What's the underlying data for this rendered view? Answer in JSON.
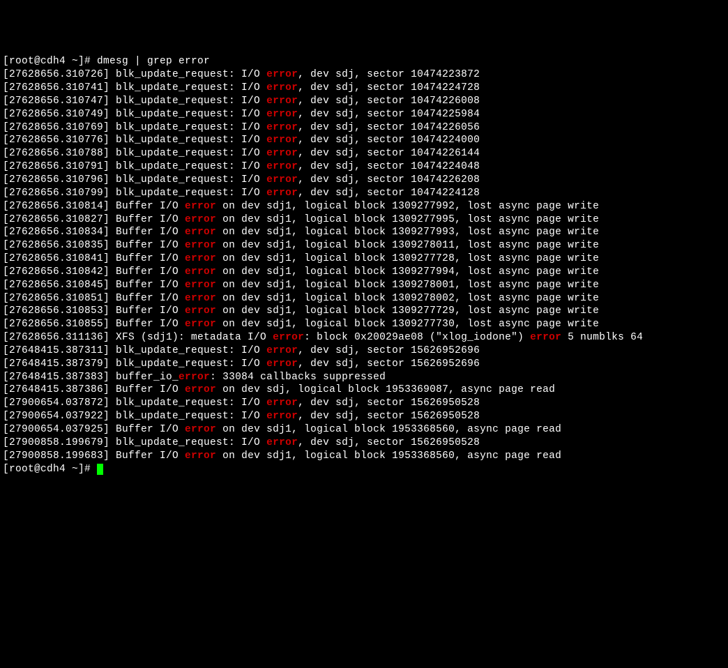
{
  "prompt1": {
    "user": "[root@cdh4 ~]# ",
    "command": "dmesg | grep error"
  },
  "blk_errors": [
    {
      "ts": "27628656.310726",
      "sector": "10474223872"
    },
    {
      "ts": "27628656.310741",
      "sector": "10474224728"
    },
    {
      "ts": "27628656.310747",
      "sector": "10474226008"
    },
    {
      "ts": "27628656.310749",
      "sector": "10474225984"
    },
    {
      "ts": "27628656.310769",
      "sector": "10474226056"
    },
    {
      "ts": "27628656.310776",
      "sector": "10474224000"
    },
    {
      "ts": "27628656.310788",
      "sector": "10474226144"
    },
    {
      "ts": "27628656.310791",
      "sector": "10474224048"
    },
    {
      "ts": "27628656.310796",
      "sector": "10474226208"
    },
    {
      "ts": "27628656.310799",
      "sector": "10474224128"
    }
  ],
  "buffer_errors": [
    {
      "ts": "27628656.310814",
      "block": "1309277992"
    },
    {
      "ts": "27628656.310827",
      "block": "1309277995"
    },
    {
      "ts": "27628656.310834",
      "block": "1309277993"
    },
    {
      "ts": "27628656.310835",
      "block": "1309278011"
    },
    {
      "ts": "27628656.310841",
      "block": "1309277728"
    },
    {
      "ts": "27628656.310842",
      "block": "1309277994"
    },
    {
      "ts": "27628656.310845",
      "block": "1309278001"
    },
    {
      "ts": "27628656.310851",
      "block": "1309278002"
    },
    {
      "ts": "27628656.310853",
      "block": "1309277729"
    },
    {
      "ts": "27628656.310855",
      "block": "1309277730"
    }
  ],
  "xfs_error": {
    "ts": "27628656.311136",
    "pre": "XFS (sdj1): metadata I/O ",
    "mid": ": block 0x20029ae08 (\"xlog_iodone\") ",
    "post": " 5 numblks 64"
  },
  "late_errors": [
    {
      "ts": "27648415.387311",
      "type": "blk",
      "text_pre": "blk_update_request: I/O ",
      "text_post": ", dev sdj, sector 15626952696"
    },
    {
      "ts": "27648415.387379",
      "type": "blk",
      "text_pre": "blk_update_request: I/O ",
      "text_post": ", dev sdj, sector 15626952696"
    },
    {
      "ts": "27648415.387383",
      "type": "suppress",
      "text_pre": "buffer_io_",
      "text_post": ": 33084 callbacks suppressed"
    },
    {
      "ts": "27648415.387386",
      "type": "buf",
      "text_pre": "Buffer I/O ",
      "text_post": " on dev sdj, logical block 1953369087, async page read"
    },
    {
      "ts": "27900654.037872",
      "type": "blk",
      "text_pre": "blk_update_request: I/O ",
      "text_post": ", dev sdj, sector 15626950528"
    },
    {
      "ts": "27900654.037922",
      "type": "blk",
      "text_pre": "blk_update_request: I/O ",
      "text_post": ", dev sdj, sector 15626950528"
    },
    {
      "ts": "27900654.037925",
      "type": "buf",
      "text_pre": "Buffer I/O ",
      "text_post": " on dev sdj1, logical block 1953368560, async page read"
    },
    {
      "ts": "27900858.199679",
      "type": "blk",
      "text_pre": "blk_update_request: I/O ",
      "text_post": ", dev sdj, sector 15626950528"
    },
    {
      "ts": "27900858.199683",
      "type": "buf",
      "text_pre": "Buffer I/O ",
      "text_post": " on dev sdj1, logical block 1953368560, async page read"
    }
  ],
  "prompt2": {
    "user": "[root@cdh4 ~]# "
  },
  "labels": {
    "error": "error",
    "blk_prefix": "blk_update_request: I/O ",
    "blk_suffix_dev": ", dev sdj, sector ",
    "buf_prefix": "Buffer I/O ",
    "buf_mid": " on dev sdj1, logical block ",
    "buf_suffix": ", lost async page write"
  }
}
